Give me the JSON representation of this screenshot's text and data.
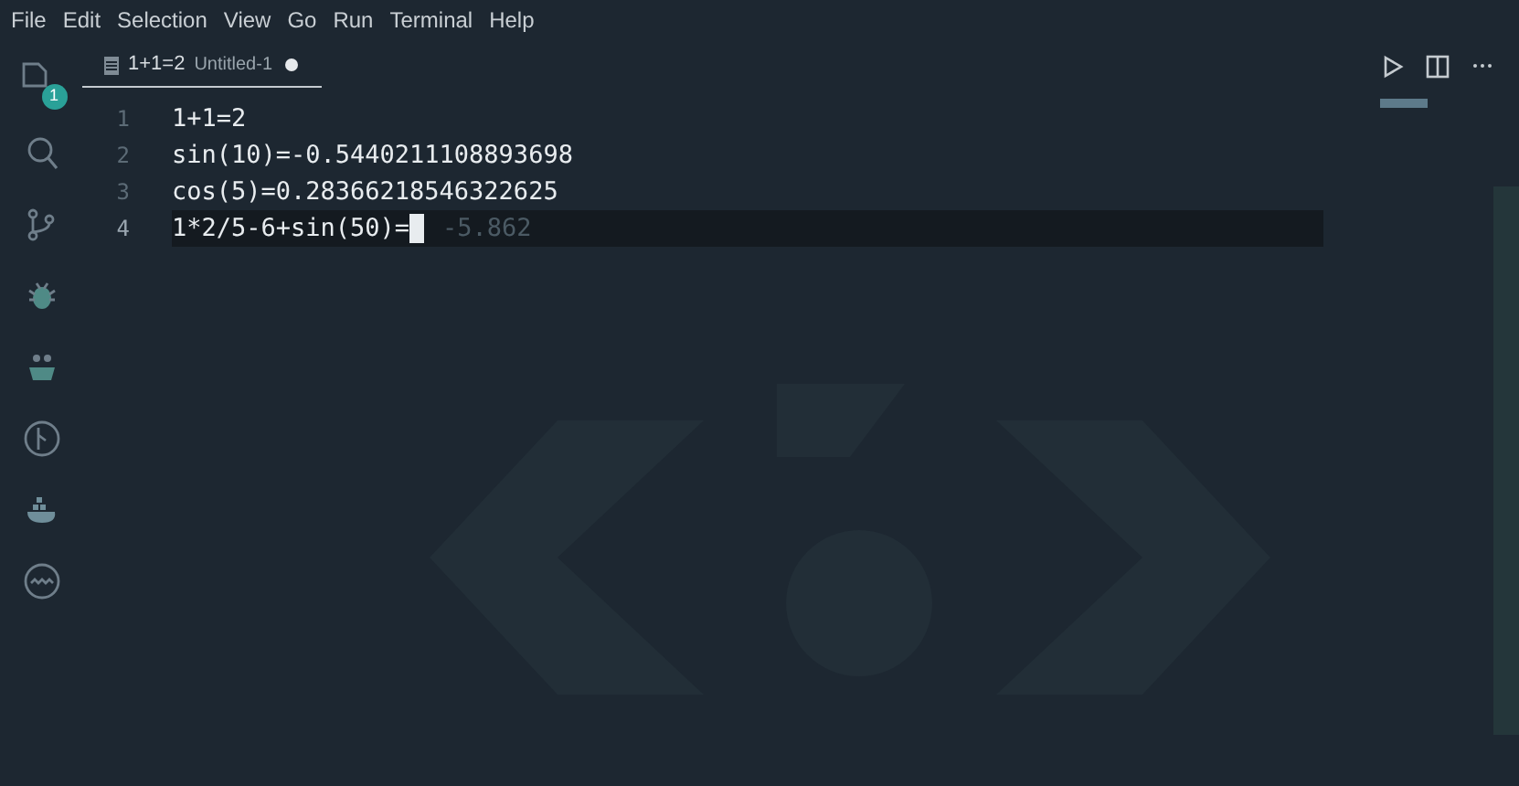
{
  "menu_bar": [
    "File",
    "Edit",
    "Selection",
    "View",
    "Go",
    "Run",
    "Terminal",
    "Help"
  ],
  "activity_bar": {
    "explorer_badge": "1"
  },
  "tabs": [
    {
      "label": "1+1=2",
      "description": "Untitled-1",
      "dirty": true,
      "selected": true
    }
  ],
  "editor": {
    "lines": [
      {
        "number": "1",
        "text": "1+1=2",
        "active": false
      },
      {
        "number": "2",
        "text": "sin(10)=-0.5440211108893698",
        "active": false
      },
      {
        "number": "3",
        "text": "cos(5)=0.28366218546322625",
        "active": false
      },
      {
        "number": "4",
        "text": "1*2/5-6+sin(50)=",
        "active": true,
        "inline_result": "-5.862"
      }
    ]
  }
}
